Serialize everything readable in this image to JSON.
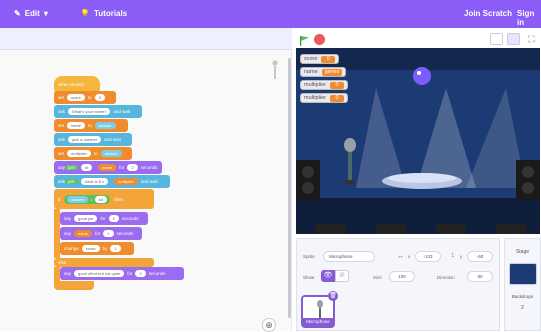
{
  "topbar": {
    "edit": "Edit",
    "tutorials": "Tutorials",
    "join": "Join Scratch",
    "signin": "Sign in"
  },
  "stage": {
    "variables": [
      {
        "name": "score",
        "value": "0"
      },
      {
        "name": "name",
        "value": "james"
      },
      {
        "name": "multiplier",
        "value": "0"
      },
      {
        "name": "multiplier",
        "value": "0"
      }
    ]
  },
  "blocks": {
    "when_flag": "when clicked",
    "set1": "set",
    "set1_var": "score",
    "set1_to": "to",
    "set1_val": "0",
    "ask1": "ask",
    "ask1_q": "What's your name?",
    "ask1_wait": "and wait",
    "set2": "set",
    "set2_var": "name",
    "set2_to": "to",
    "set2_val": "answer",
    "ask2": "ask",
    "ask2_q": "pick a number",
    "ask2_wait": "and wait",
    "set3": "set",
    "set3_var": "multiplier",
    "set3_to": "to",
    "set3_val": "answer",
    "say1": "say",
    "say1_a": "join",
    "say1_b": "hi",
    "say1_c": "name",
    "say1_for": "for",
    "say1_secs": "2",
    "say1_sec_lbl": "seconds",
    "ask3": "ask",
    "ask3_a": "join",
    "ask3_b": "what is 8 x",
    "ask3_c": "multiplier",
    "ask3_wait": "and wait",
    "if1": "if",
    "if1_a": "answer",
    "if1_eq": "=",
    "if1_b": "64",
    "if1_then": "then",
    "say2": "say",
    "say2_a": "good job",
    "say2_for": "for",
    "say2_secs": "2",
    "say2_sec_lbl": "seconds",
    "say3": "say",
    "say3_a": "name",
    "say3_for": "for",
    "say3_secs": "1",
    "say3_sec_lbl": "seconds",
    "change1": "change",
    "change1_var": "score",
    "change1_by": "by",
    "change1_val": "1",
    "else1": "else",
    "say4": "say",
    "say4_a": "good effort but not quite",
    "say4_for": "for",
    "say4_secs": "2",
    "say4_sec_lbl": "seconds"
  },
  "sprite_info": {
    "sprite_label": "Sprite",
    "sprite_name": "Microphone",
    "x_label": "x",
    "x_value": "-133",
    "y_label": "y",
    "y_value": "-60",
    "show_label": "Show",
    "size_label": "Size",
    "size_value": "100",
    "direction_label": "Direction",
    "direction_value": "90",
    "thumb_label": "Microphone"
  },
  "stage_panel": {
    "title": "Stage",
    "backdrops_label": "Backdrops",
    "backdrops_count": "2"
  }
}
